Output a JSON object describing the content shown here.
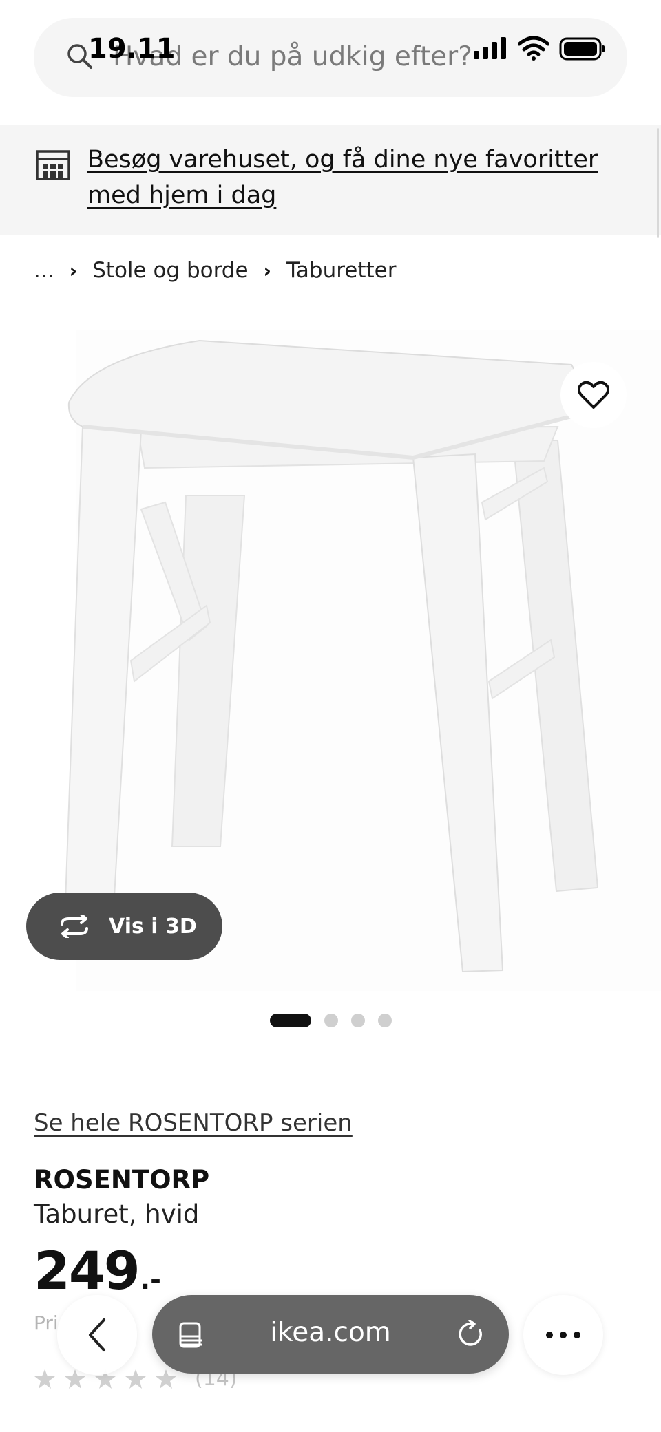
{
  "status_bar": {
    "time": "19.11"
  },
  "search": {
    "placeholder": "Hvad er du på udkig efter?"
  },
  "store_banner": {
    "text": "Besøg varehuset, og få dine nye favoritter med hjem i dag"
  },
  "breadcrumb": {
    "items": [
      "...",
      "Stole og borde",
      "Taburetter"
    ]
  },
  "product_image": {
    "button_3d_label": "Vis i 3D",
    "carousel_count": 4,
    "active_index": 0
  },
  "product": {
    "series_link": "Se hele ROSENTORP serien",
    "name": "ROSENTORP",
    "description": "Taburet, hvid",
    "price_main": "249",
    "price_suffix": ".-",
    "price_note": "Pri",
    "rating_count": "(14)",
    "rating_stars": 5
  },
  "browser": {
    "url": "ikea.com"
  },
  "icons": [
    "search-icon",
    "signal-icon",
    "wifi-icon",
    "battery-icon",
    "store-icon",
    "heart-icon",
    "rotate-3d-icon",
    "star-icon",
    "back-chevron-icon",
    "reader-icon",
    "reload-icon",
    "more-icon"
  ],
  "colors": {
    "banner_bg": "#f5f5f5",
    "dark_button": "#4d4d4d",
    "url_pill": "#666666"
  }
}
